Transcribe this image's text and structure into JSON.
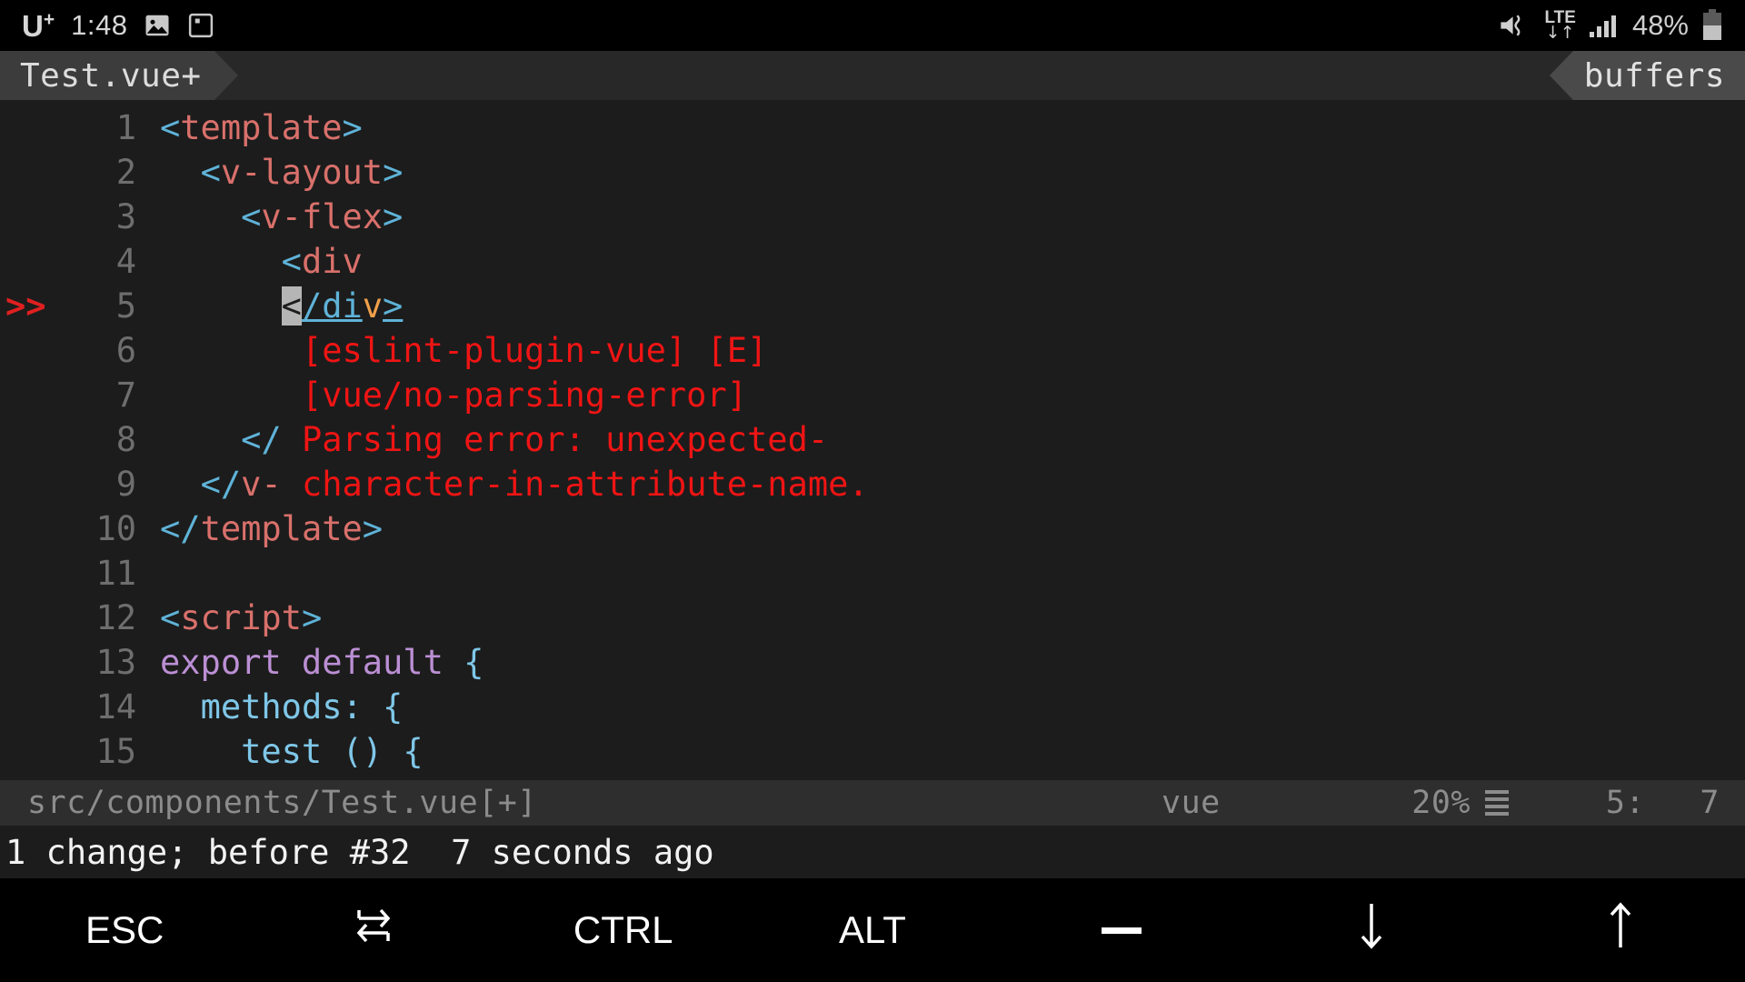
{
  "statusbar": {
    "carrier": "U",
    "carrier_sup": "+",
    "clock": "1:48",
    "icons": [
      "image-icon",
      "screenshot-icon"
    ],
    "mute_icon": "mute-icon",
    "network_label": "LTE",
    "network_arrows": "↓↑",
    "signal_icon": "signal-bars-icon",
    "battery_percent": "48%",
    "battery_icon": "battery-icon"
  },
  "tabline": {
    "tab_label": "Test.vue+",
    "buffers_label": "buffers"
  },
  "editor": {
    "lines": [
      {
        "num": "1",
        "mark": "",
        "indent": 0
      },
      {
        "num": "2",
        "mark": "",
        "indent": 1
      },
      {
        "num": "3",
        "mark": "",
        "indent": 2
      },
      {
        "num": "4",
        "mark": "",
        "indent": 3
      },
      {
        "num": "5",
        "mark": ">>",
        "indent": 3
      },
      {
        "num": "6",
        "mark": "",
        "indent": 4
      },
      {
        "num": "7",
        "mark": "",
        "indent": 4
      },
      {
        "num": "8",
        "mark": "",
        "indent": 2
      },
      {
        "num": "9",
        "mark": "",
        "indent": 1
      },
      {
        "num": "10",
        "mark": "",
        "indent": 0
      },
      {
        "num": "11",
        "mark": "",
        "indent": 0
      },
      {
        "num": "12",
        "mark": "",
        "indent": 0
      },
      {
        "num": "13",
        "mark": "",
        "indent": 0
      },
      {
        "num": "14",
        "mark": "",
        "indent": 1
      },
      {
        "num": "15",
        "mark": "",
        "indent": 2
      }
    ],
    "text": {
      "l1_open": "<",
      "l1_tag": "template",
      "l1_close": ">",
      "l2_open": "<",
      "l2_tag": "v-layout",
      "l2_close": ">",
      "l3_open": "<",
      "l3_tag": "v-flex",
      "l3_close": ">",
      "l4_open": "<",
      "l4_tag": "div",
      "l5_cursor": "<",
      "l5_slashdi": "/di",
      "l5_v": "v",
      "l5_gt": ">",
      "l6_err": "[eslint-plugin-vue] [E]",
      "l7_err": "[vue/no-parsing-error]",
      "l8_open": "</",
      "l8_err": " Parsing error: unexpected-",
      "l9_open": "</",
      "l9_tag": "v-",
      "l9_err": " character-in-attribute-name.",
      "l10_open": "</",
      "l10_tag": "template",
      "l10_close": ">",
      "l11_blank": "",
      "l12_open": "<",
      "l12_tag": "script",
      "l12_close": ">",
      "l13_kw": "export default",
      "l13_brace": " {",
      "l14_id": "methods:",
      "l14_brace": " {",
      "l15_id": "test ()",
      "l15_brace": " {"
    }
  },
  "vimstatus": {
    "filepath": "src/components/Test.vue[+]",
    "filetype": "vue",
    "percent": "20%",
    "lines_icon": "lines-icon",
    "line_pos": "5:",
    "col_pos": "7"
  },
  "message": "1 change; before #32  7 seconds ago",
  "keybar": {
    "keys": [
      {
        "label": "ESC",
        "icon": ""
      },
      {
        "label": "",
        "icon": "tab-icon"
      },
      {
        "label": "CTRL",
        "icon": ""
      },
      {
        "label": "ALT",
        "icon": ""
      },
      {
        "label": "",
        "icon": "dash-icon"
      },
      {
        "label": "↓",
        "icon": "arrow-down-icon"
      },
      {
        "label": "↑",
        "icon": "arrow-up-icon"
      }
    ]
  },
  "colors": {
    "editor_bg": "#1c1c1c",
    "tabline_bg": "#282828",
    "bracket": "#5fb3d8",
    "tag": "#d9706b",
    "error": "#ef1414",
    "keyword": "#bb8fd4",
    "identifier": "#7fc7e8",
    "orange": "#f0a04b",
    "linenum": "#6e6e6e"
  }
}
